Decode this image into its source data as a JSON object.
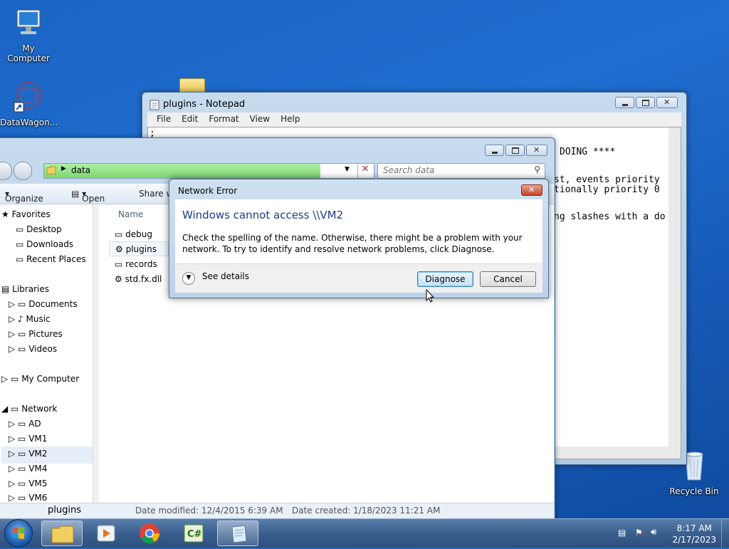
{
  "desktop": {
    "icons": [
      {
        "label": "My Computer"
      },
      {
        "label": "DataWagon..."
      },
      {
        "label": "Recycle Bin"
      }
    ]
  },
  "notepad": {
    "title": "plugins - Notepad",
    "menu": [
      "File",
      "Edit",
      "Format",
      "View",
      "Help"
    ],
    "lines": [
      ";",
      "DOING ****",
      "st, events priority",
      "tionally priority 0",
      "ng slashes with a do"
    ]
  },
  "explorer": {
    "address": "data",
    "search_placeholder": "Search data",
    "toolbar": {
      "organize": "Organize",
      "open": "Open",
      "share": "Share wi"
    },
    "column_name": "Name",
    "nav": {
      "favorites": "Favorites",
      "desktop": "Desktop",
      "downloads": "Downloads",
      "recent": "Recent Places",
      "libraries": "Libraries",
      "documents": "Documents",
      "music": "Music",
      "pictures": "Pictures",
      "videos": "Videos",
      "mycomputer": "My Computer",
      "network": "Network",
      "ad": "AD",
      "vm1": "VM1",
      "vm2": "VM2",
      "vm4": "VM4",
      "vm5": "VM5",
      "vm6": "VM6"
    },
    "files": [
      "debug",
      "plugins",
      "records",
      "std.fx.dll"
    ],
    "status": {
      "name": "plugins",
      "modified": "Date modified: 12/4/2015 6:39 AM",
      "created": "Date created: 1/18/2023 11:21 AM"
    }
  },
  "dialog": {
    "title": "Network Error",
    "heading": "Windows cannot access \\\\VM2",
    "message": "Check the spelling of the name. Otherwise, there might be a problem with your network. To try to identify and resolve network problems, click Diagnose.",
    "see_details": "See details",
    "diagnose": "Diagnose",
    "cancel": "Cancel"
  },
  "taskbar": {
    "time": "8:17 AM",
    "date": "2/17/2023"
  }
}
